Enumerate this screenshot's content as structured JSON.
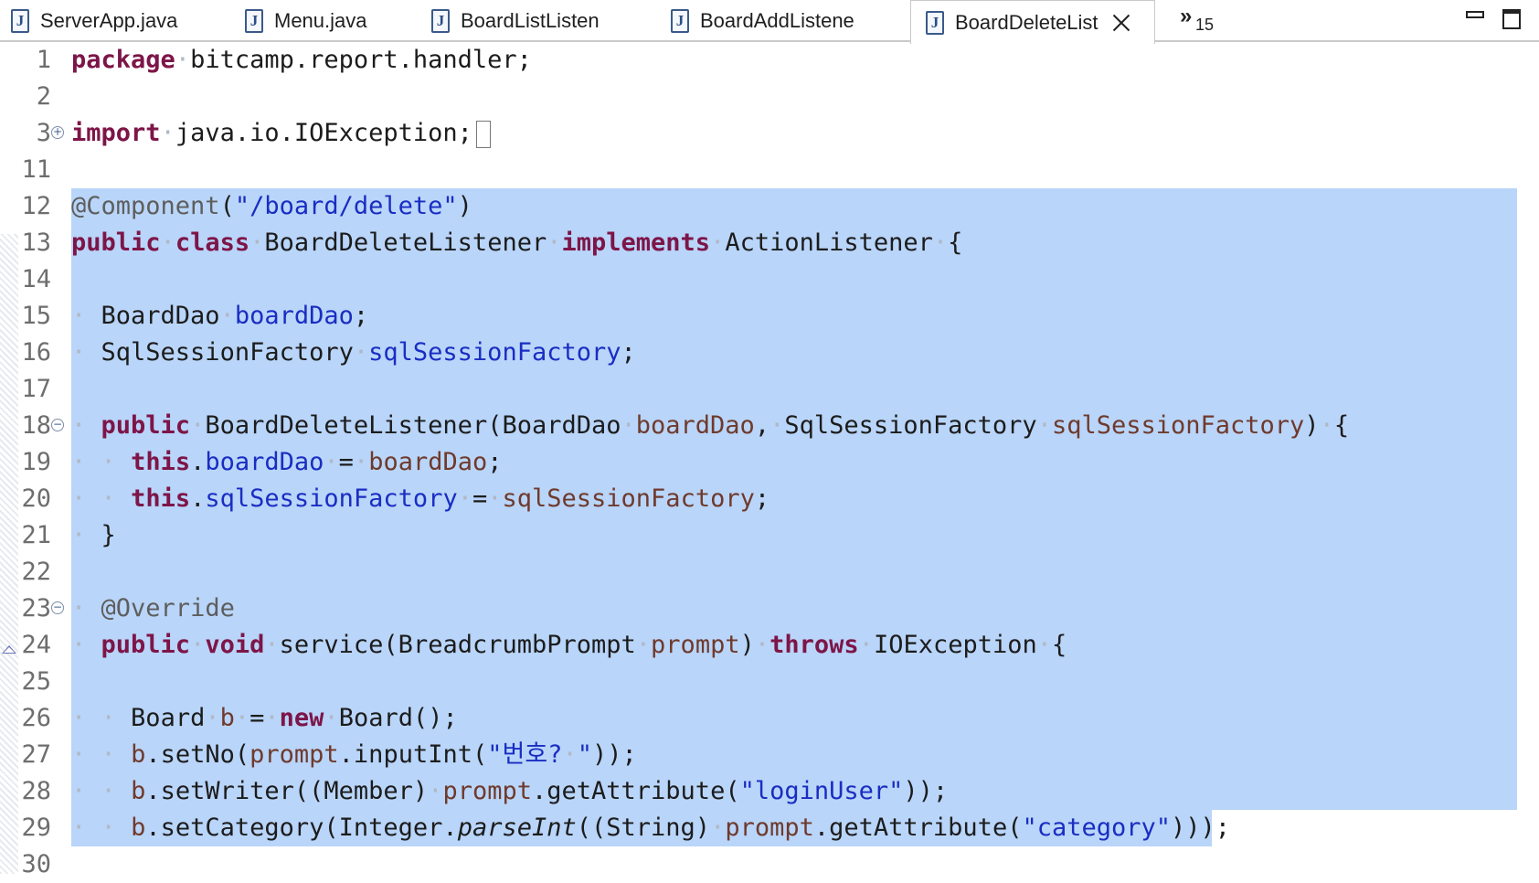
{
  "tabs": [
    {
      "label": "ServerApp.java",
      "active": false
    },
    {
      "label": "Menu.java",
      "active": false
    },
    {
      "label": "BoardListListen",
      "active": false
    },
    {
      "label": "BoardAddListene",
      "active": false
    },
    {
      "label": "BoardDeleteList",
      "active": true
    }
  ],
  "overflow": {
    "symbol": "»",
    "count": "15"
  },
  "editor": {
    "selection_color": "#b9d5f9",
    "lines": [
      {
        "n": "1",
        "text": "package bitcamp.report.handler;"
      },
      {
        "n": "2",
        "text": ""
      },
      {
        "n": "3",
        "text": "import java.io.IOException;"
      },
      {
        "n": "11",
        "text": ""
      },
      {
        "n": "12",
        "text": "@Component(\"/board/delete\")"
      },
      {
        "n": "13",
        "text": "public class BoardDeleteListener implements ActionListener {"
      },
      {
        "n": "14",
        "text": ""
      },
      {
        "n": "15",
        "text": "  BoardDao boardDao;"
      },
      {
        "n": "16",
        "text": "  SqlSessionFactory sqlSessionFactory;"
      },
      {
        "n": "17",
        "text": ""
      },
      {
        "n": "18",
        "text": "  public BoardDeleteListener(BoardDao boardDao, SqlSessionFactory sqlSessionFactory) {"
      },
      {
        "n": "19",
        "text": "    this.boardDao = boardDao;"
      },
      {
        "n": "20",
        "text": "    this.sqlSessionFactory = sqlSessionFactory;"
      },
      {
        "n": "21",
        "text": "  }"
      },
      {
        "n": "22",
        "text": ""
      },
      {
        "n": "23",
        "text": "  @Override"
      },
      {
        "n": "24",
        "text": "  public void service(BreadcrumbPrompt prompt) throws IOException {"
      },
      {
        "n": "25",
        "text": ""
      },
      {
        "n": "26",
        "text": "    Board b = new Board();"
      },
      {
        "n": "27",
        "text": "    b.setNo(prompt.inputInt(\"번호? \"));"
      },
      {
        "n": "28",
        "text": "    b.setWriter((Member) prompt.getAttribute(\"loginUser\"));"
      },
      {
        "n": "29",
        "text": "    b.setCategory(Integer.parseInt((String) prompt.getAttribute(\"category\")));"
      },
      {
        "n": "30",
        "text": ""
      }
    ]
  }
}
